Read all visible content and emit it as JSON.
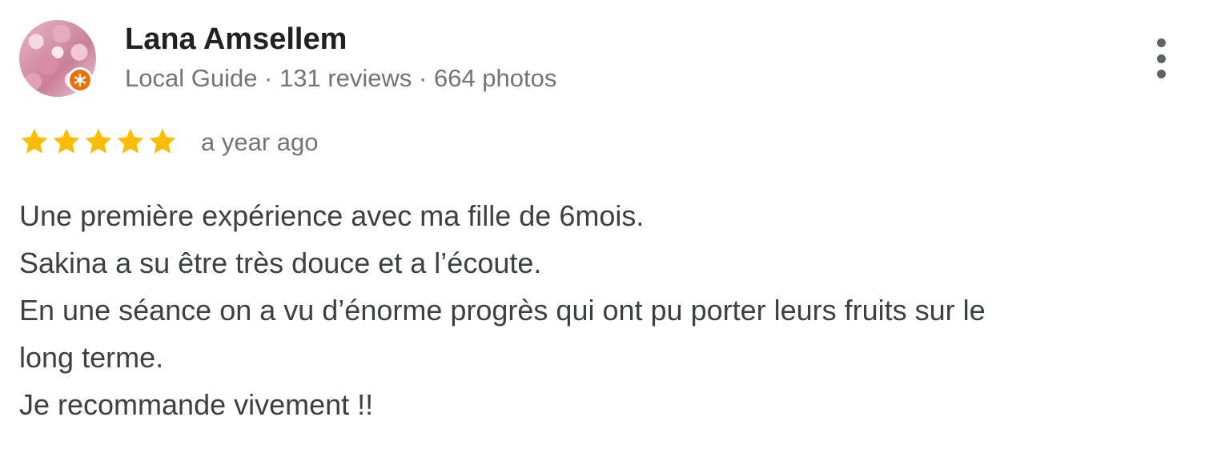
{
  "reviewer": {
    "name": "Lana Amsellem",
    "meta": "Local Guide · 131 reviews · 664 photos",
    "avatar_icon": "profile-photo-pink-flowers",
    "badge_icon": "local-guide-badge-icon",
    "badge_color": "#e8710a"
  },
  "review": {
    "rating": 5,
    "rating_max": 5,
    "star_color": "#fbbc04",
    "date": "a year ago",
    "lines": [
      "Une première expérience avec ma fille de 6mois.",
      "Sakina a su être très douce et a l’écoute.",
      "En une séance on a vu d’énorme progrès qui ont pu porter leurs fruits sur le",
      "long terme.",
      "Je recommande vivement !!"
    ]
  },
  "actions": {
    "more_icon": "more-vert-icon"
  }
}
